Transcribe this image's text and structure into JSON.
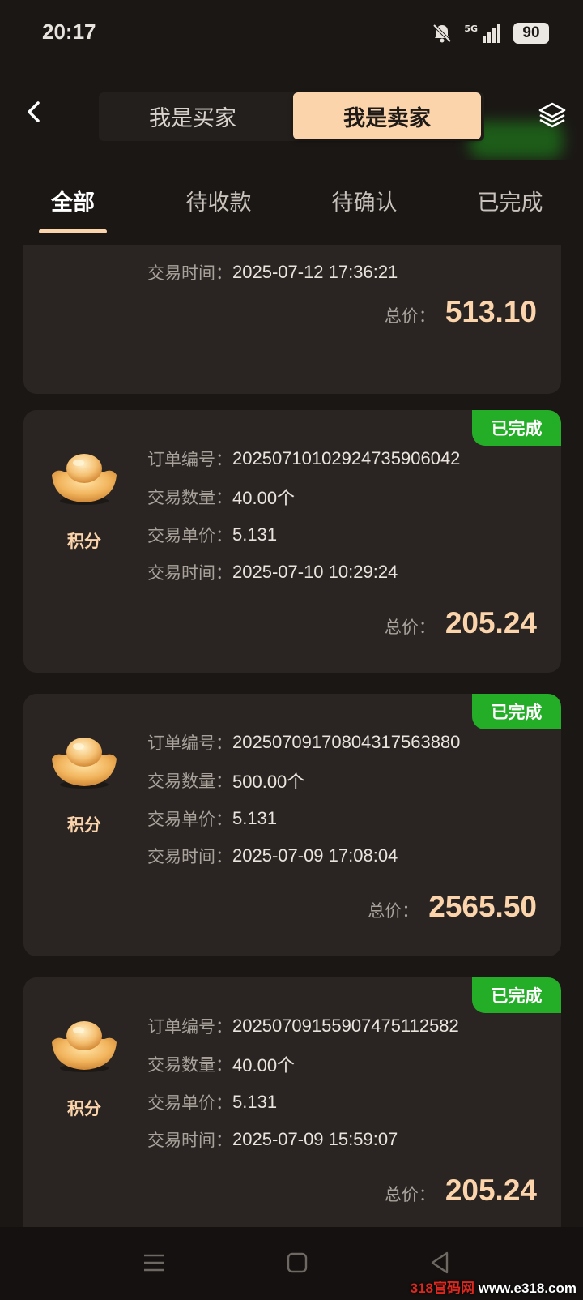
{
  "status_bar": {
    "time": "20:17",
    "network": "5G",
    "battery": "90"
  },
  "header": {
    "back_icon": "chevron-left-icon",
    "segments": {
      "buyer": "我是买家",
      "seller": "我是卖家",
      "active": "seller"
    },
    "layers_icon": "layers-icon"
  },
  "filter_tabs": [
    {
      "label": "全部",
      "active": true
    },
    {
      "label": "待收款",
      "active": false
    },
    {
      "label": "待确认",
      "active": false
    },
    {
      "label": "已完成",
      "active": false
    }
  ],
  "orders": [
    {
      "partial": true,
      "time_label": "交易时间：",
      "time": "2025-07-12 17:36:21",
      "total_label": "总价：",
      "total": "513.10"
    },
    {
      "status": "已完成",
      "coin_icon": "gold-ingot-icon",
      "product": "积分",
      "order_no_label": "订单编号：",
      "order_no": "20250710102924735906042",
      "qty_label": "交易数量：",
      "qty": "40.00个",
      "price_label": "交易单价：",
      "price": "5.131",
      "time_label": "交易时间：",
      "time": "2025-07-10 10:29:24",
      "total_label": "总价：",
      "total": "205.24"
    },
    {
      "status": "已完成",
      "coin_icon": "gold-ingot-icon",
      "product": "积分",
      "order_no_label": "订单编号：",
      "order_no": "20250709170804317563880",
      "qty_label": "交易数量：",
      "qty": "500.00个",
      "price_label": "交易单价：",
      "price": "5.131",
      "time_label": "交易时间：",
      "time": "2025-07-09 17:08:04",
      "total_label": "总价：",
      "total": "2565.50"
    },
    {
      "status": "已完成",
      "coin_icon": "gold-ingot-icon",
      "product": "积分",
      "order_no_label": "订单编号：",
      "order_no": "20250709155907475112582",
      "qty_label": "交易数量：",
      "qty": "40.00个",
      "price_label": "交易单价：",
      "price": "5.131",
      "time_label": "交易时间：",
      "time": "2025-07-09 15:59:07",
      "total_label": "总价：",
      "total": "205.24"
    }
  ],
  "nav_bar": {
    "icons": [
      "menu-icon",
      "home-square-icon",
      "back-triangle-icon"
    ]
  },
  "watermark": {
    "brand": "318官码网",
    "url": "www.e318.com"
  },
  "colors": {
    "accent": "#fbd4ab",
    "badge_green": "#24ad27",
    "background": "#1b1715",
    "card": "#2a2522"
  }
}
